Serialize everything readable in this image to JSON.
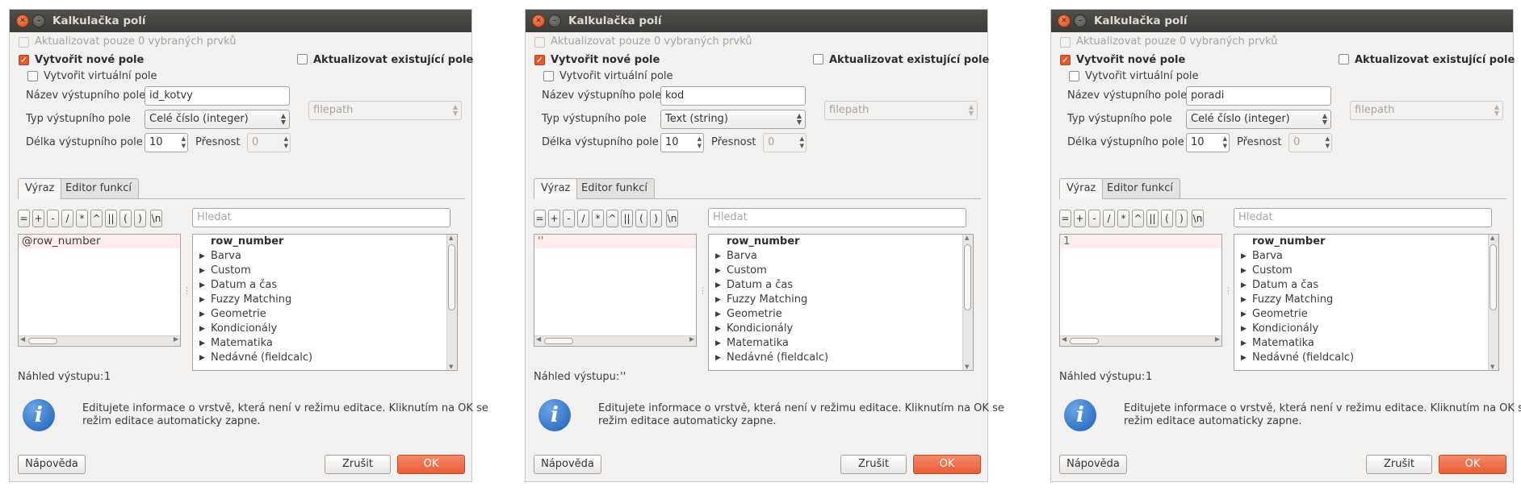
{
  "dialog_title": "Kalkulačka polí",
  "labels": {
    "update_selected": "Aktualizovat pouze 0 vybraných prvků",
    "create_new_field": "Vytvořit nové pole",
    "update_existing": "Aktualizovat existující pole",
    "create_virtual": "Vytvořit virtuální pole",
    "output_name": "Název výstupního pole",
    "output_type": "Typ výstupního pole",
    "output_length": "Délka výstupního pole",
    "precision": "Přesnost",
    "tab_expression": "Výraz",
    "tab_function_editor": "Editor funkcí",
    "search_placeholder": "Hledat",
    "preview_label": "Náhled výstupu:",
    "info_line1": "Editujete informace o vrstvě, která není v režimu editace. Kliknutím na OK se",
    "info_line2": "režim editace automaticky zapne.",
    "help": "Nápověda",
    "cancel": "Zrušit",
    "ok": "OK",
    "existing_field": "filepath"
  },
  "operators": [
    "=",
    "+",
    "-",
    "/",
    "*",
    "^",
    "||",
    "(",
    ")",
    "\\n"
  ],
  "function_groups": [
    "row_number",
    "Barva",
    "Custom",
    "Datum a čas",
    "Fuzzy Matching",
    "Geometrie",
    "Kondicionály",
    "Matematika",
    "Nedávné (fieldcalc)"
  ],
  "accent_color": "#e75d35",
  "dialogs": [
    {
      "field_name": "id_kotvy",
      "field_type": "Celé číslo (integer)",
      "length": "10",
      "precision": "0",
      "expression": "@row_number",
      "expression_color": "#3c3c3c",
      "preview": "1"
    },
    {
      "field_name": "kod",
      "field_type": "Text (string)",
      "length": "10",
      "precision": "0",
      "expression": "''",
      "expression_color": "#c04a27",
      "preview": "''"
    },
    {
      "field_name": "poradi",
      "field_type": "Celé číslo (integer)",
      "length": "10",
      "precision": "0",
      "expression": "1",
      "expression_color": "#2a8a8a",
      "preview": "1"
    }
  ]
}
